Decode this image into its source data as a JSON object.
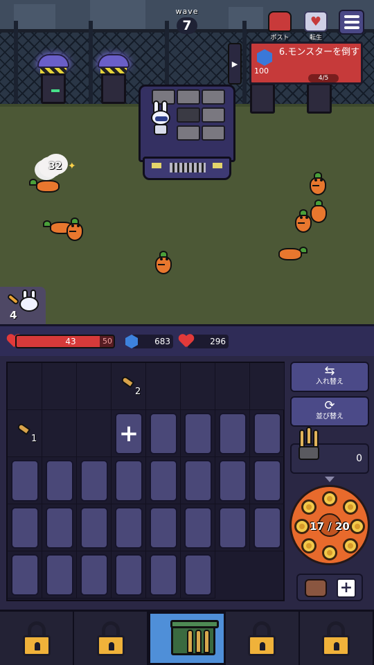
{
  "wave": {
    "label": "wave",
    "number": "7"
  },
  "top_buttons": {
    "post_label": "ポスト",
    "rebirth_label": "転生"
  },
  "mission": {
    "title": "6.モンスターを倒す",
    "reward": "100",
    "progress": "4/5",
    "progress_fraction": 0.8
  },
  "battle": {
    "damage_popup": "32",
    "ally_count": "4"
  },
  "status": {
    "hp_current": "43",
    "hp_max": "50",
    "hp_fraction": 0.86,
    "gems": "683",
    "hearts": "296"
  },
  "inventory": {
    "bullet_slots": [
      {
        "count": "2"
      },
      {
        "count": "1"
      }
    ],
    "add_symbol": "+"
  },
  "side_buttons": {
    "swap_symbol": "⇆",
    "swap_label": "入れ替え",
    "sort_symbol": "⟳",
    "sort_label": "並び替え",
    "ammo_count": "0",
    "add_symbol": "+"
  },
  "revolver": {
    "current": "17",
    "capacity": "20",
    "display": "17 / 20"
  },
  "nav": {
    "tabs": [
      {
        "name": "locked",
        "icon": "lock-icon"
      },
      {
        "name": "locked",
        "icon": "lock-icon"
      },
      {
        "name": "ammo-crate",
        "icon": "ammo-crate-icon",
        "active": true
      },
      {
        "name": "locked",
        "icon": "lock-icon"
      },
      {
        "name": "locked",
        "icon": "lock-icon"
      }
    ]
  },
  "colors": {
    "hp": "#d63a3a",
    "mission": "#c63a3a",
    "gem": "#3d82dd",
    "active_tab": "#4f8fd8",
    "revolver": "#e86a2c"
  }
}
